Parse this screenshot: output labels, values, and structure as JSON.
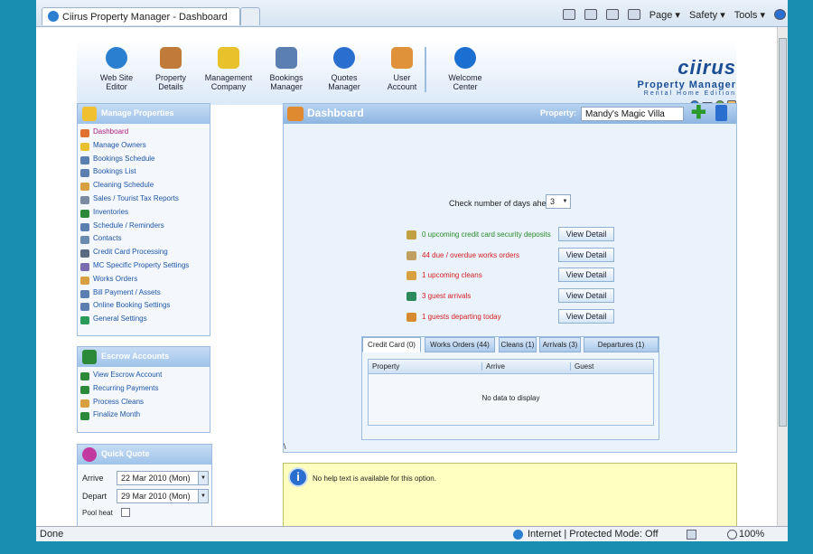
{
  "browser": {
    "tab_title": "Ciirus Property Manager - Dashboard",
    "menu": {
      "page": "Page ▾",
      "safety": "Safety ▾",
      "tools": "Tools ▾"
    },
    "status_text": "Done",
    "zone_text": "Internet | Protected Mode: Off",
    "zoom": "100%"
  },
  "toolbar": [
    {
      "label1": "Web Site",
      "label2": "Editor",
      "icon": "globe-icon",
      "color": "#2a7fd0"
    },
    {
      "label1": "Property",
      "label2": "Details",
      "icon": "house-icon",
      "color": "#c07a3a"
    },
    {
      "label1": "Management",
      "label2": "Company",
      "icon": "puzzle-icon",
      "color": "#e8c22a"
    },
    {
      "label1": "Bookings",
      "label2": "Manager",
      "icon": "calendar-icon",
      "color": "#5a7fb0"
    },
    {
      "label1": "Quotes",
      "label2": "Manager",
      "icon": "quote-icon",
      "color": "#2a6fd0"
    },
    {
      "label1": "User",
      "label2": "Account",
      "icon": "users-icon",
      "color": "#e0923a"
    },
    {
      "label1": "Welcome",
      "label2": "Center",
      "icon": "help-icon",
      "color": "#1a6fd0"
    }
  ],
  "logo": {
    "name": "ciirus",
    "title": "Property Manager",
    "edition": "Rental Home Edition"
  },
  "manage_properties": {
    "title": "Manage Properties",
    "items": [
      "Dashboard",
      "Manage Owners",
      "Bookings Schedule",
      "Bookings List",
      "Cleaning Schedule",
      "Sales / Tourist Tax Reports",
      "Inventories",
      "Schedule / Reminders",
      "Contacts",
      "Credit Card Processing",
      "MC Specific Property Settings",
      "Works Orders",
      "Bill Payment / Assets",
      "Online Booking Settings",
      "General Settings"
    ]
  },
  "escrow": {
    "title": "Escrow Accounts",
    "items": [
      "View Escrow Account",
      "Recurring Payments",
      "Process Cleans",
      "Finalize Month"
    ]
  },
  "quick_quote": {
    "title": "Quick Quote",
    "arrive_label": "Arrive",
    "arrive_value": "22 Mar 2010 (Mon)",
    "depart_label": "Depart",
    "depart_value": "29 Mar 2010 (Mon)",
    "pool_label": "Pool heat"
  },
  "dashboard": {
    "title": "Dashboard",
    "property_label": "Property:",
    "property_value": "Mandy's Magic Villa",
    "days_label": "Check number of days ahead",
    "days_value": "3",
    "alerts": [
      {
        "text": "0 upcoming credit card security deposits",
        "color": "#2a8a2a",
        "button": "View Detail"
      },
      {
        "text": "44 due / overdue works orders",
        "color": "#d42020",
        "button": "View Detail"
      },
      {
        "text": "1 upcoming cleans",
        "color": "#d42020",
        "button": "View Detail"
      },
      {
        "text": "3 guest arrivals",
        "color": "#d42020",
        "button": "View Detail"
      },
      {
        "text": "1 guests departing today",
        "color": "#d42020",
        "button": "View Detail"
      }
    ],
    "tabs": [
      "Credit Card (0)",
      "Works Orders (44)",
      "Cleans (1)",
      "Arrivals (3)",
      "Departures (1)"
    ],
    "columns": [
      "Property",
      "Arrive",
      "Guest"
    ],
    "empty_text": "No data to display",
    "stray_mark": "\\"
  },
  "help": {
    "text": "No help text is available for this option."
  }
}
